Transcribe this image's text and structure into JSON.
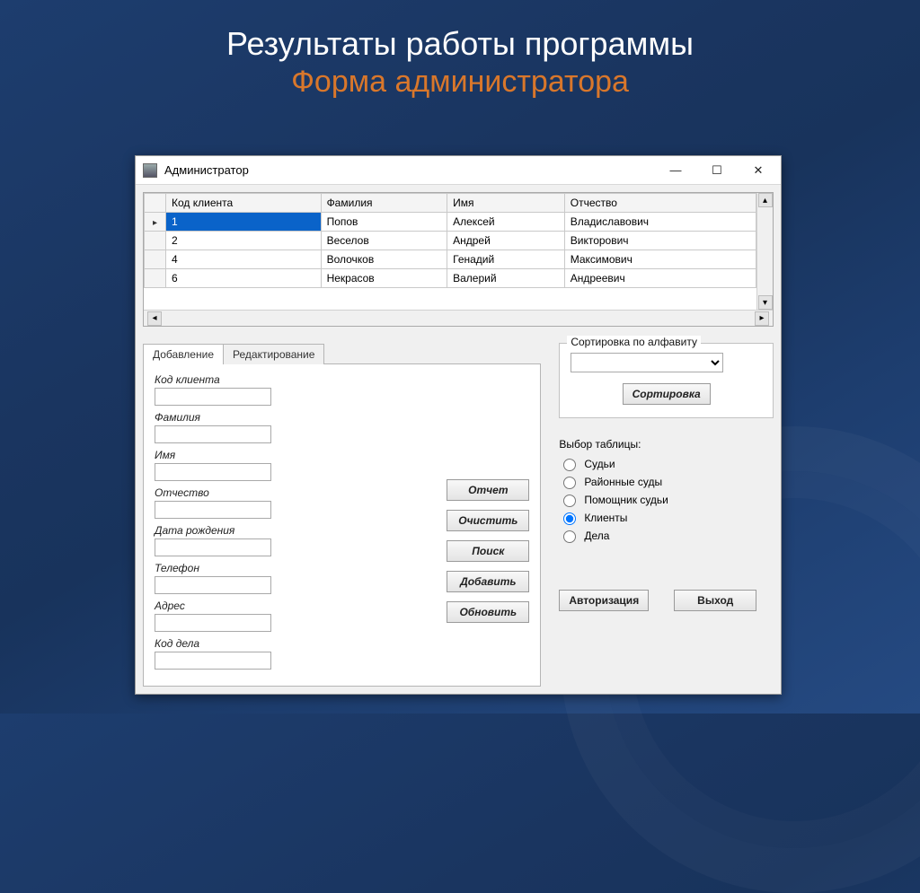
{
  "slide": {
    "title": "Результаты работы программы",
    "subtitle": "Форма администратора"
  },
  "window": {
    "title": "Администратор"
  },
  "grid": {
    "headers": [
      "Код клиента",
      "Фамилия",
      "Имя",
      "Отчество"
    ],
    "rows": [
      {
        "code": "1",
        "last": "Попов",
        "first": "Алексей",
        "patr": "Владиславович",
        "selected": true
      },
      {
        "code": "2",
        "last": "Веселов",
        "first": "Андрей",
        "patr": "Викторович"
      },
      {
        "code": "4",
        "last": "Волочков",
        "first": "Генадий",
        "patr": "Максимович"
      },
      {
        "code": "6",
        "last": "Некрасов",
        "first": "Валерий",
        "patr": "Андреевич"
      }
    ]
  },
  "tabs": {
    "add": "Добавление",
    "edit": "Редактирование"
  },
  "form": {
    "labels": {
      "code": "Код клиента",
      "last": "Фамилия",
      "first": "Имя",
      "patr": "Отчество",
      "dob": "Дата рождения",
      "phone": "Телефон",
      "addr": "Адрес",
      "case": "Код дела"
    },
    "buttons": {
      "report": "Отчет",
      "clear": "Очистить",
      "search": "Поиск",
      "add": "Добавить",
      "update": "Обновить"
    }
  },
  "sort": {
    "title": "Сортировка по алфавиту",
    "button": "Сортировка"
  },
  "tableSelect": {
    "title": "Выбор таблицы:",
    "options": {
      "judges": "Судьи",
      "courts": "Районные суды",
      "assist": "Помощник судьи",
      "clients": "Клиенты",
      "cases": "Дела"
    },
    "selected": "clients"
  },
  "bottom": {
    "auth": "Авторизация",
    "exit": "Выход"
  }
}
